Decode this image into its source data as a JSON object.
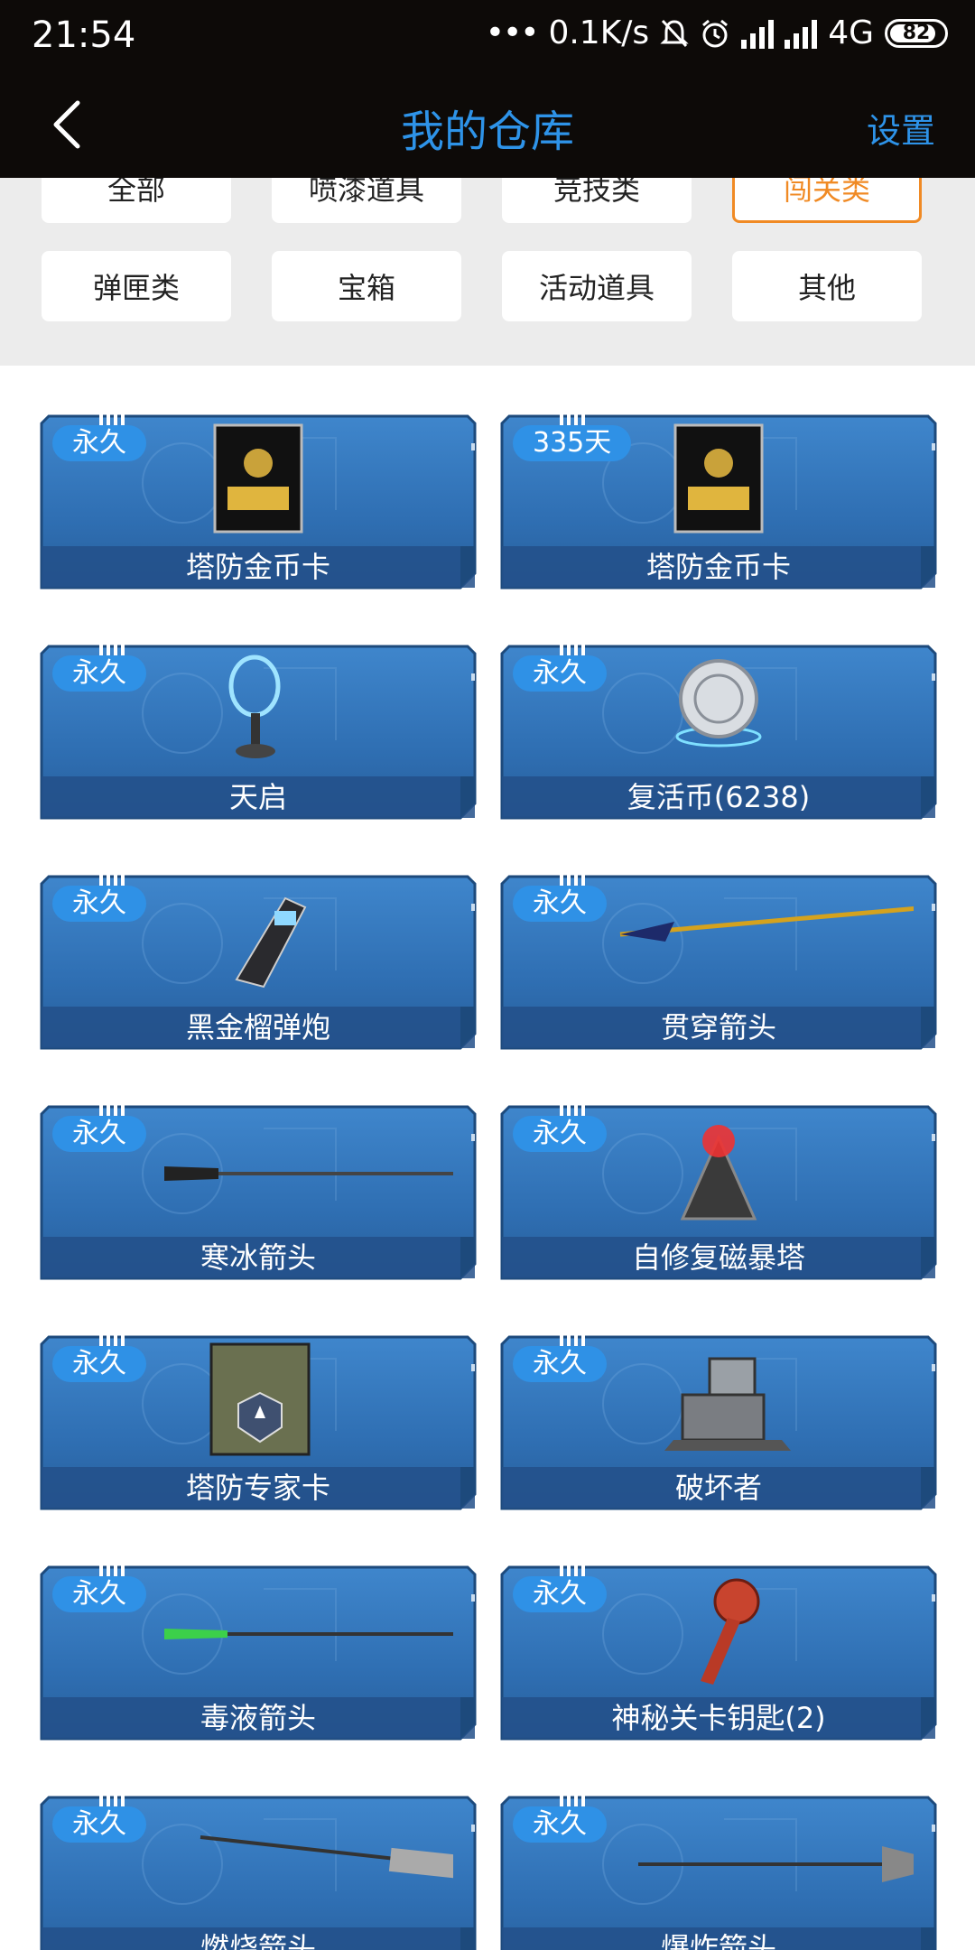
{
  "status_bar": {
    "time": "21:54",
    "net_speed": "0.1K/s",
    "network": "4G",
    "battery": "82"
  },
  "header": {
    "title": "我的仓库",
    "settings_label": "设置"
  },
  "categories": [
    {
      "label": "全部",
      "active": false
    },
    {
      "label": "喷漆道具",
      "active": false
    },
    {
      "label": "竞技类",
      "active": false
    },
    {
      "label": "闯关类",
      "active": true
    },
    {
      "label": "弹匣类",
      "active": false
    },
    {
      "label": "宝箱",
      "active": false
    },
    {
      "label": "活动道具",
      "active": false
    },
    {
      "label": "其他",
      "active": false
    }
  ],
  "items": [
    {
      "badge": "永久",
      "name": "塔防金币卡",
      "icon": "gold-coin-card-icon"
    },
    {
      "badge": "335天",
      "name": "塔防金币卡",
      "icon": "gold-coin-card-icon"
    },
    {
      "badge": "永久",
      "name": "天启",
      "icon": "apocalypse-tower-icon"
    },
    {
      "badge": "永久",
      "name": "复活币(6238)",
      "icon": "revive-coin-icon"
    },
    {
      "badge": "永久",
      "name": "黑金榴弹炮",
      "icon": "grenade-launcher-icon"
    },
    {
      "badge": "永久",
      "name": "贯穿箭头",
      "icon": "piercing-arrow-icon"
    },
    {
      "badge": "永久",
      "name": "寒冰箭头",
      "icon": "ice-arrow-icon"
    },
    {
      "badge": "永久",
      "name": "自修复磁暴塔",
      "icon": "tesla-tower-icon"
    },
    {
      "badge": "永久",
      "name": "塔防专家卡",
      "icon": "expert-card-icon"
    },
    {
      "badge": "永久",
      "name": "破坏者",
      "icon": "destroyer-turret-icon"
    },
    {
      "badge": "永久",
      "name": "毒液箭头",
      "icon": "venom-arrow-icon"
    },
    {
      "badge": "永久",
      "name": "神秘关卡钥匙(2)",
      "icon": "mystery-key-icon"
    },
    {
      "badge": "永久",
      "name": "燃烧箭头",
      "icon": "fire-arrow-icon"
    },
    {
      "badge": "永久",
      "name": "爆炸箭头",
      "icon": "explosive-arrow-icon"
    }
  ],
  "colors": {
    "accent": "#2e93e8",
    "active_category": "#f08a24",
    "card_blue": "#2f6fb3",
    "header_bg": "#0d0a08"
  }
}
